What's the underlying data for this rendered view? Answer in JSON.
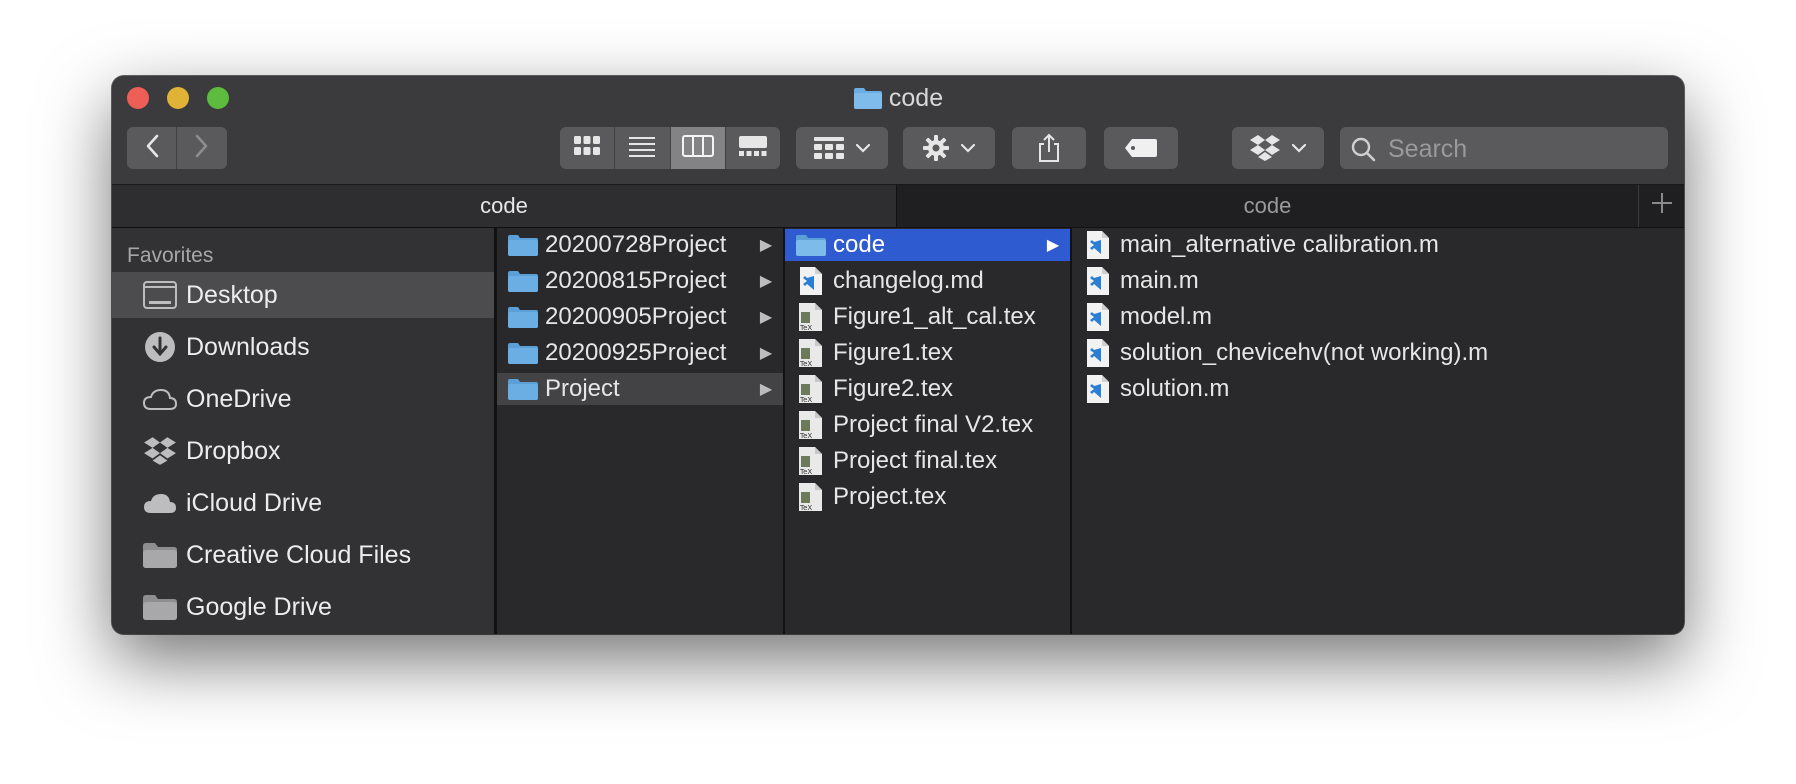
{
  "window": {
    "title": "code"
  },
  "toolbar": {
    "back_icon": "chevron-left-icon",
    "forward_icon": "chevron-right-icon",
    "view_modes": [
      "icon-view-icon",
      "list-view-icon",
      "column-view-icon",
      "gallery-view-icon"
    ],
    "active_view": "column-view-icon",
    "group_icon": "group-by-icon",
    "action_icon": "gear-icon",
    "share_icon": "share-icon",
    "tag_icon": "tag-icon",
    "dropbox_icon": "dropbox-icon",
    "search_placeholder": "Search"
  },
  "tabs": [
    {
      "label": "code",
      "active": true
    },
    {
      "label": "code",
      "active": false
    }
  ],
  "sidebar": {
    "heading": "Favorites",
    "items": [
      {
        "label": "Desktop",
        "icon": "desktop-icon",
        "selected": true
      },
      {
        "label": "Downloads",
        "icon": "downloads-icon",
        "selected": false
      },
      {
        "label": "OneDrive",
        "icon": "cloud-icon",
        "selected": false
      },
      {
        "label": "Dropbox",
        "icon": "dropbox-icon",
        "selected": false
      },
      {
        "label": "iCloud Drive",
        "icon": "icloud-icon",
        "selected": false
      },
      {
        "label": "Creative Cloud Files",
        "icon": "folder-icon",
        "selected": false
      },
      {
        "label": "Google Drive",
        "icon": "folder-icon",
        "selected": false
      }
    ]
  },
  "columns": {
    "col1": [
      {
        "label": "20200728Project",
        "type": "folder"
      },
      {
        "label": "20200815Project",
        "type": "folder"
      },
      {
        "label": "20200905Project",
        "type": "folder"
      },
      {
        "label": "20200925Project",
        "type": "folder"
      },
      {
        "label": "Project",
        "type": "folder",
        "selected": "grey"
      }
    ],
    "col2": [
      {
        "label": "code",
        "type": "folder",
        "selected": "blue"
      },
      {
        "label": "changelog.md",
        "type": "vscode"
      },
      {
        "label": "Figure1_alt_cal.tex",
        "type": "tex"
      },
      {
        "label": "Figure1.tex",
        "type": "tex"
      },
      {
        "label": "Figure2.tex",
        "type": "tex"
      },
      {
        "label": "Project final V2.tex",
        "type": "tex"
      },
      {
        "label": "Project final.tex",
        "type": "tex"
      },
      {
        "label": "Project.tex",
        "type": "tex"
      }
    ],
    "col3": [
      {
        "label": "main_alternative calibration.m",
        "type": "vscode"
      },
      {
        "label": "main.m",
        "type": "vscode"
      },
      {
        "label": "model.m",
        "type": "vscode"
      },
      {
        "label": "solution_chevicehv(not working).m",
        "type": "vscode"
      },
      {
        "label": "solution.m",
        "type": "vscode"
      }
    ]
  },
  "colors": {
    "selection_blue": "#2e5bd0",
    "folder_blue": "#6aaee4",
    "close": "#ec5e56",
    "minimize": "#e0b236",
    "maximize": "#5dbb3e"
  }
}
